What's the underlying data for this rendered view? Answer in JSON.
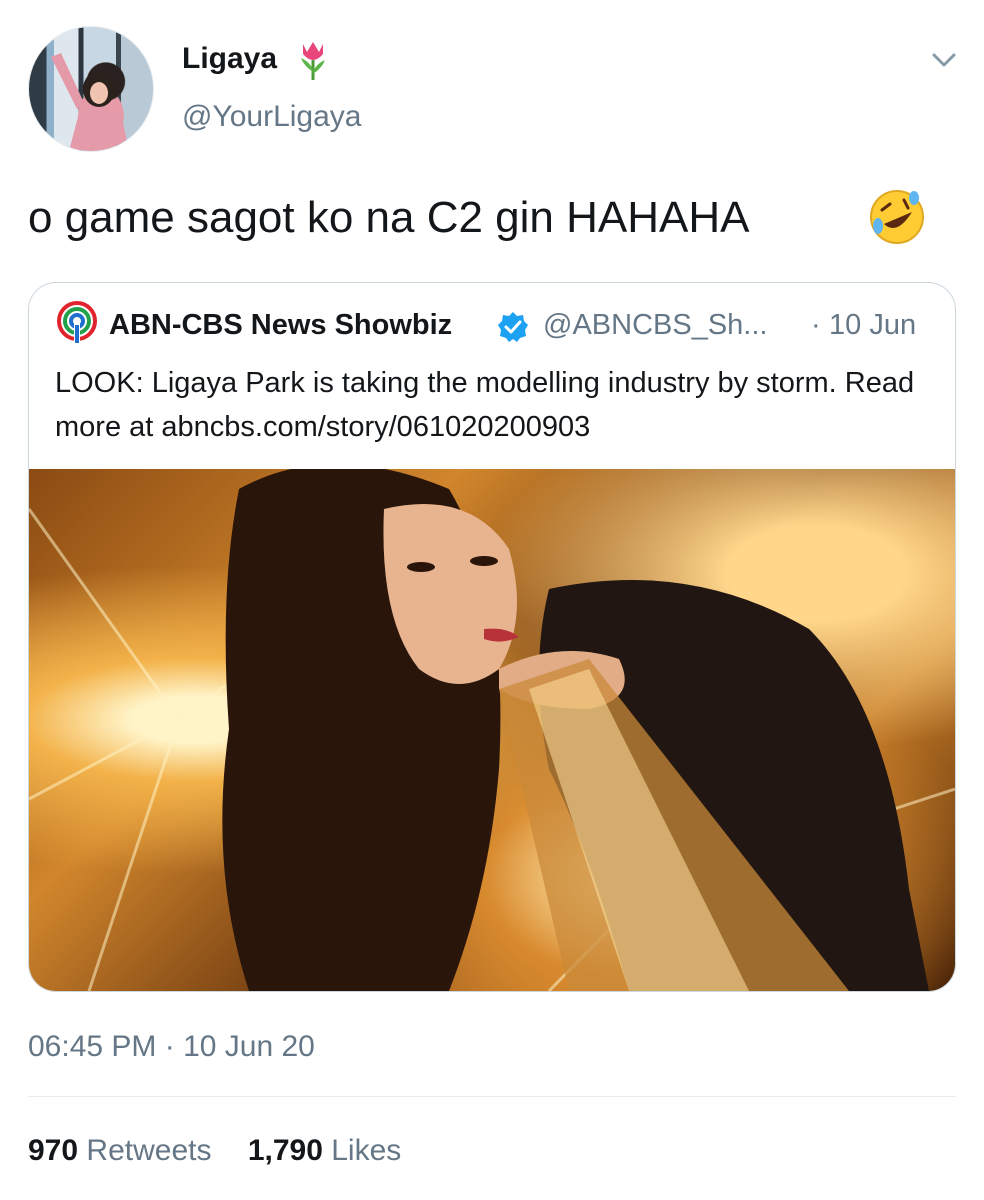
{
  "tweet": {
    "display_name": "Ligaya",
    "name_emoji": "tulip-icon",
    "handle": "@YourLigaya",
    "text": "o game sagot ko na C2 gin HAHAHA",
    "text_emoji": "rolling-on-the-floor-laughing-icon",
    "timestamp": "06:45 PM · 10 Jun 20",
    "retweets_count": "970",
    "retweets_label": "Retweets",
    "likes_count": "1,790",
    "likes_label": "Likes"
  },
  "quoted": {
    "name": "ABN-CBS News Showbiz",
    "verified": true,
    "handle": "@ABNCBS_Sh...",
    "separator": "·",
    "date": "10 Jun",
    "text": "LOOK: Ligaya Park is taking the modelling industry by storm. Read more at abncbs.com/story/061020200903"
  },
  "colors": {
    "text": "#14171a",
    "secondary": "#657786",
    "border": "#ccd6dd",
    "verified": "#1da1f2"
  }
}
